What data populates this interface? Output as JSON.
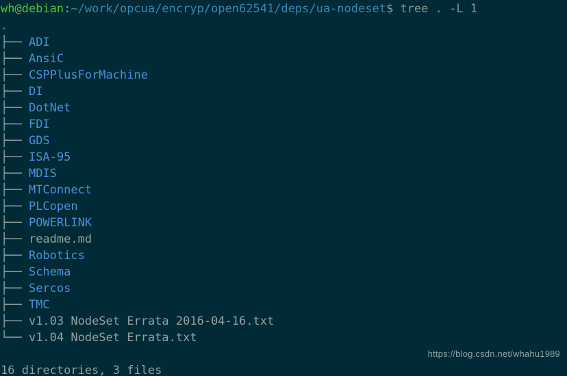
{
  "terminal": {
    "prompt": {
      "user_host": "wh@debian",
      "separator": ":",
      "path": "~/work/opcua/encryp/open62541/deps/ua-nodeset",
      "dollar": "$",
      "command": " tree . -L 1"
    },
    "root_label": ".",
    "tree_entries": [
      {
        "branch": "├── ",
        "name": "ADI",
        "kind": "dir"
      },
      {
        "branch": "├── ",
        "name": "AnsiC",
        "kind": "dir"
      },
      {
        "branch": "├── ",
        "name": "CSPPlusForMachine",
        "kind": "dir"
      },
      {
        "branch": "├── ",
        "name": "DI",
        "kind": "dir"
      },
      {
        "branch": "├── ",
        "name": "DotNet",
        "kind": "dir"
      },
      {
        "branch": "├── ",
        "name": "FDI",
        "kind": "dir"
      },
      {
        "branch": "├── ",
        "name": "GDS",
        "kind": "dir"
      },
      {
        "branch": "├── ",
        "name": "ISA-95",
        "kind": "dir"
      },
      {
        "branch": "├── ",
        "name": "MDIS",
        "kind": "dir"
      },
      {
        "branch": "├── ",
        "name": "MTConnect",
        "kind": "dir"
      },
      {
        "branch": "├── ",
        "name": "PLCopen",
        "kind": "dir"
      },
      {
        "branch": "├── ",
        "name": "POWERLINK",
        "kind": "dir"
      },
      {
        "branch": "├── ",
        "name": "readme.md",
        "kind": "file"
      },
      {
        "branch": "├── ",
        "name": "Robotics",
        "kind": "dir"
      },
      {
        "branch": "├── ",
        "name": "Schema",
        "kind": "dir"
      },
      {
        "branch": "├── ",
        "name": "Sercos",
        "kind": "dir"
      },
      {
        "branch": "├── ",
        "name": "TMC",
        "kind": "dir"
      },
      {
        "branch": "├── ",
        "name": "v1.03 NodeSet Errata 2016-04-16.txt",
        "kind": "file"
      },
      {
        "branch": "└── ",
        "name": "v1.04 NodeSet Errata.txt",
        "kind": "file"
      }
    ],
    "summary": "16 directories, 3 files",
    "watermark": "https://blog.csdn.net/whahu1989",
    "colors": {
      "background": "#002b36",
      "prompt_user": "#4ec33a",
      "prompt_path": "#3a86b0",
      "directory": "#4a90d9",
      "file": "#93a1a1",
      "branch": "#93a1a1",
      "watermark": "#8fa3a8"
    }
  }
}
